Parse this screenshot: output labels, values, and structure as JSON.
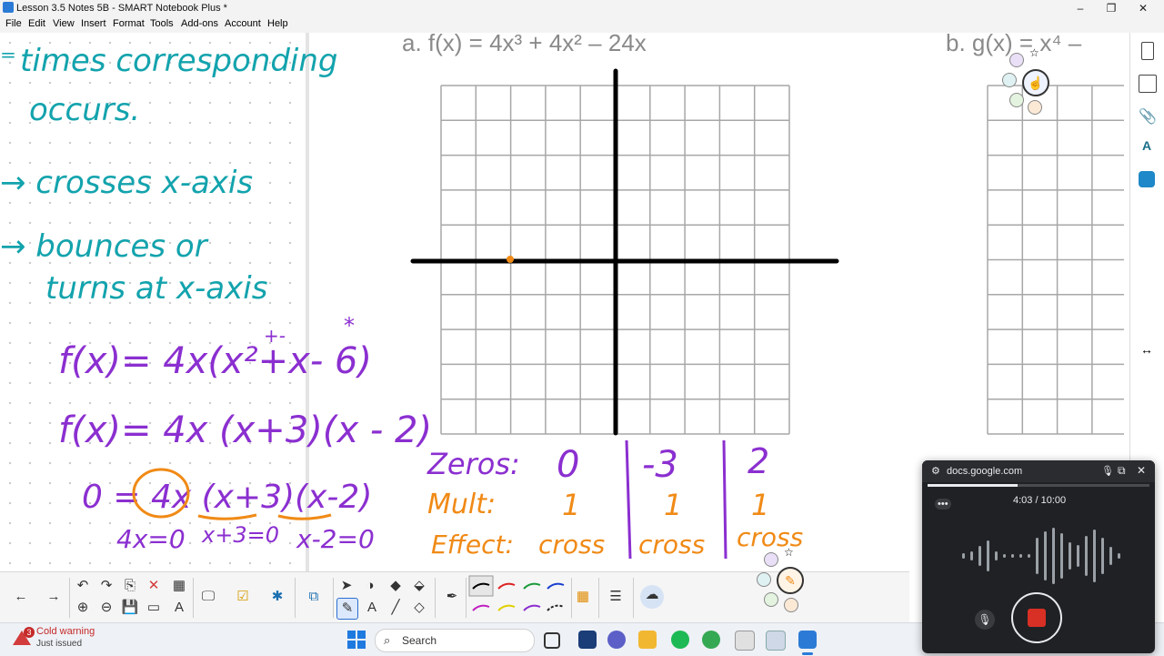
{
  "window": {
    "title": "Lesson 3.5 Notes 5B - SMART Notebook Plus *",
    "controls": [
      "–",
      "❐",
      "✕"
    ]
  },
  "menu": [
    "File",
    "Edit",
    "View",
    "Insert",
    "Format",
    "Tools",
    "Add-ons",
    "Account",
    "Help"
  ],
  "notes": {
    "line1": "times corresponding",
    "line2": "occurs.",
    "line3": "→ crosses x-axis",
    "line4": "→ bounces or",
    "line5": "turns at x-axis",
    "star": "*",
    "plusminus": "+-",
    "eq1": "f(x)= 4x(x²+x- 6)",
    "eq2": "f(x)= 4x (x+3)(x - 2)",
    "eq3": "0 = 4x (x+3)(x-2)",
    "eq4a": "4x=0",
    "eq4b": "x+3=0",
    "eq4c": "x-2=0"
  },
  "problem_a": "a.  f(x) = 4x³ + 4x² – 24x",
  "problem_b": "b.  g(x) = x⁴ –",
  "table": {
    "zeros_label": "Zeros:",
    "mult_label": "Mult:",
    "effect_label": "Effect:",
    "zeros": [
      "0",
      "-3",
      "2"
    ],
    "mult": [
      "1",
      "1",
      "1"
    ],
    "effect": [
      "cross",
      "cross",
      "cross"
    ]
  },
  "colors": {
    "teal": "#13a3ad",
    "purple": "#8b2fd0",
    "orange": "#f08a16",
    "grid": "#9a9a9a"
  },
  "recorder": {
    "source": "docs.google.com",
    "timer": "4:03 / 10:00",
    "progress": 0.405,
    "dots": "•••"
  },
  "taskbar": {
    "weather_title": "Cold warning",
    "weather_sub": "Just issued",
    "weather_badge": "3",
    "search_placeholder": "Search"
  }
}
